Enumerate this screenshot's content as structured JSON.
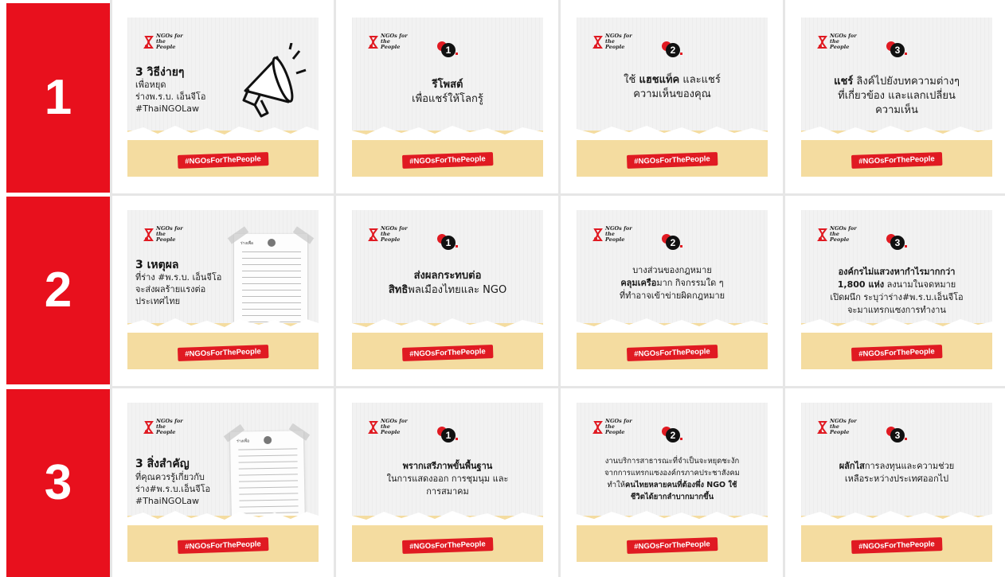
{
  "rows": [
    {
      "number": "1"
    },
    {
      "number": "2"
    },
    {
      "number": "3"
    }
  ],
  "hashtag": "#NGOsForThePeople",
  "brand": {
    "line1": "NGOs for",
    "line2": "the People"
  },
  "cards": {
    "r1c1": {
      "title": "3 วิธีง่ายๆ",
      "sub1": "เพื่อหยุด",
      "sub2": "ร่างพ.ร.บ. เอ็นจีโอ",
      "sub3": "#ThaiNGOLaw"
    },
    "r1c2": {
      "num": "1",
      "l1": "รีโพสต์",
      "l2": "เพื่อแชร์ให้โลกรู้"
    },
    "r1c3": {
      "num": "2",
      "l1a": "ใช้ ",
      "l1b": "แฮชแท็ค",
      "l1c": " และแชร์",
      "l2": "ความเห็นของคุณ"
    },
    "r1c4": {
      "num": "3",
      "l1a": "แชร์",
      "l1b": " ลิงค์ไปยังบทความต่างๆ",
      "l2": "ที่เกี่ยวข้อง และแลกเปลี่ยน",
      "l3": "ความเห็น"
    },
    "r2c1": {
      "title": "3 เหตุผล",
      "sub1": "ที่ร่าง #พ.ร.บ. เอ็นจีโอ",
      "sub2": "จะส่งผลร้ายแรงต่อ",
      "sub3": "ประเทศไทย",
      "doc_head": "ร่างเพื่อ"
    },
    "r2c2": {
      "num": "1",
      "l1": "ส่งผลกระทบต่อ",
      "l2a": "สิทธิ",
      "l2b": "พลเมืองไทยและ NGO"
    },
    "r2c3": {
      "num": "2",
      "l1": "บางส่วนของกฎหมาย",
      "l2a": "คลุมเครือ",
      "l2b": "มาก กิจกรรมใด ๆ",
      "l3": "ที่ทำอาจเข้าข่ายผิดกฎหมาย"
    },
    "r2c4": {
      "num": "3",
      "l1": "องค์กรไม่แสวงหากำไรมากกว่า",
      "l2a": "1,800 แห่ง",
      "l2b": " ลงนามในจดหมาย",
      "l3": "เปิดผนึก ระบุว่าร่าง#พ.ร.บ.เอ็นจีโอ",
      "l4": "จะมาแทรกแซงการทำงาน"
    },
    "r3c1": {
      "title": "3 สิ่งสำคัญ",
      "sub1": "ที่คุณควรรู้เกี่ยวกับ",
      "sub2": "ร่าง#พ.ร.บ.เอ็นจีโอ",
      "sub3": "#ThaiNGOLaw",
      "doc_head": "ร่างเพื่อ"
    },
    "r3c2": {
      "num": "1",
      "l1": "พรากเสรีภาพขั้นพื้นฐาน",
      "l2": "ในการแสดงออก การชุมนุม และ",
      "l3": "การสมาคม"
    },
    "r3c3": {
      "num": "2",
      "l1": "งานบริการสาธารณะที่จำเป็นจะหยุดชะงัก",
      "l2": "จากการแทรกแซงองค์กรภาคประชาสังคม",
      "l3a": "ทำให้",
      "l3b": "คนไทยหลายคนที่ต้องพึ่ง NGO ใช้",
      "l4": "ชีวิตได้ยากลำบากมากขึ้น"
    },
    "r3c4": {
      "num": "3",
      "l1a": "ผลักไส",
      "l1b": "การลงทุนและความช่วย",
      "l2": "เหลือระหว่างประเทศออกไป"
    }
  },
  "colors": {
    "red": "#e8101d",
    "sand": "#f4dca0",
    "card": "#f2f2f2"
  },
  "icons": [
    "megaphone-icon",
    "ngo-logo-icon",
    "document-image"
  ]
}
